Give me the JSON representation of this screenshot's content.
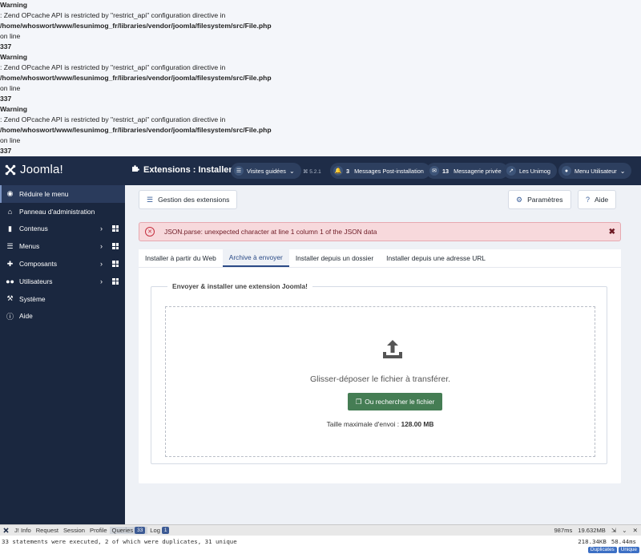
{
  "warnings": [
    {
      "label": "Warning",
      "message": ": Zend OPcache API is restricted by \"restrict_api\" configuration directive in",
      "path": "/home/whoswort/www/lesunimog_fr/libraries/vendor/joomla/filesystem/src/File.php",
      "online": "on line",
      "line": "337"
    },
    {
      "label": "Warning",
      "message": ": Zend OPcache API is restricted by \"restrict_api\" configuration directive in",
      "path": "/home/whoswort/www/lesunimog_fr/libraries/vendor/joomla/filesystem/src/File.php",
      "online": "on line",
      "line": "337"
    },
    {
      "label": "Warning",
      "message": ": Zend OPcache API is restricted by \"restrict_api\" configuration directive in",
      "path": "/home/whoswort/www/lesunimog_fr/libraries/vendor/joomla/filesystem/src/File.php",
      "online": "on line",
      "line": "337"
    }
  ],
  "header": {
    "logo": "Joomla!",
    "title": "Extensions : Installer",
    "version": "⌘ 5.2.1",
    "pills": {
      "tours": {
        "label": "Visites guidées",
        "icon": "tour-icon"
      },
      "postinstall": {
        "count": "3",
        "label": "Messages Post-installation",
        "icon": "bell-icon"
      },
      "messages": {
        "count": "13",
        "label": "Messagerie privée",
        "icon": "envelope-icon"
      },
      "site": {
        "label": "Les Unimog",
        "icon": "external-link-icon"
      },
      "user": {
        "label": "Menu Utilisateur",
        "icon": "user-icon"
      }
    }
  },
  "sidebar": {
    "items": [
      {
        "label": "Réduire le menu",
        "icon": "toggle-icon"
      },
      {
        "label": "Panneau d'administration",
        "icon": "home-icon"
      },
      {
        "label": "Contenus",
        "icon": "file-icon"
      },
      {
        "label": "Menus",
        "icon": "list-icon"
      },
      {
        "label": "Composants",
        "icon": "puzzle-icon"
      },
      {
        "label": "Utilisateurs",
        "icon": "users-icon"
      },
      {
        "label": "Système",
        "icon": "wrench-icon"
      },
      {
        "label": "Aide",
        "icon": "info-icon"
      }
    ]
  },
  "toolbar": {
    "manage_label": "Gestion des extensions",
    "options_label": "Paramètres",
    "help_label": "Aide"
  },
  "alert": {
    "message": "JSON.parse: unexpected character at line 1 column 1 of the JSON data"
  },
  "tabs": [
    {
      "label": "Installer à partir du Web"
    },
    {
      "label": "Archive à envoyer"
    },
    {
      "label": "Installer depuis un dossier"
    },
    {
      "label": "Installer depuis une adresse URL"
    }
  ],
  "upload": {
    "legend": "Envoyer & installer une extension Joomla!",
    "drop_text": "Glisser-déposer le fichier à transférer.",
    "browse_label": "Ou rechercher le fichier",
    "max_label": "Taille maximale d'envoi :",
    "max_value": "128.00 MB"
  },
  "debugbar": {
    "items": [
      "J! Info",
      "Request",
      "Session",
      "Profile",
      "Queries",
      "Log"
    ],
    "queries_count": "33",
    "log_count": "1",
    "time": "987ms",
    "memory": "19.632MB",
    "message": "33 statements were executed, 2 of which were duplicates, 31 unique",
    "size": "218.34KB",
    "duration": "58.44ms",
    "tag_duplicates": "Duplicates",
    "tag_unique": "Unique"
  },
  "colors": {
    "header_bg": "#1e2c47",
    "sidebar_bg": "#1a273f",
    "alert_bg": "#f7d9dc",
    "success_button": "#457d54",
    "active_tab": "#2a4a86"
  }
}
